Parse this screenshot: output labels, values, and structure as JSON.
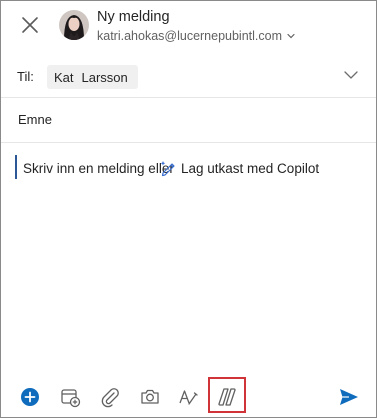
{
  "header": {
    "title": "Ny melding",
    "account": "katri.ahokas@lucernepubintl.com"
  },
  "recipients": {
    "label": "Til:",
    "chip": {
      "first": "Kat",
      "last": "Larsson"
    }
  },
  "subject": {
    "placeholder": "Emne"
  },
  "body": {
    "placeholder": "Skriv inn en melding eller",
    "copilot_label": "Lag utkast med Copilot"
  },
  "icons": {
    "close": "close-icon",
    "account_chevron": "chevron-down-icon",
    "to_chevron": "chevron-down-icon",
    "add": "add-circle-icon",
    "calendar": "calendar-add-icon",
    "attach": "paperclip-icon",
    "camera": "camera-icon",
    "format": "text-format-icon",
    "copilot": "copilot-icon",
    "send": "send-icon"
  },
  "colors": {
    "accent": "#0f6cbd",
    "highlight": "#d13438",
    "text": "#242424",
    "muted": "#616161"
  }
}
